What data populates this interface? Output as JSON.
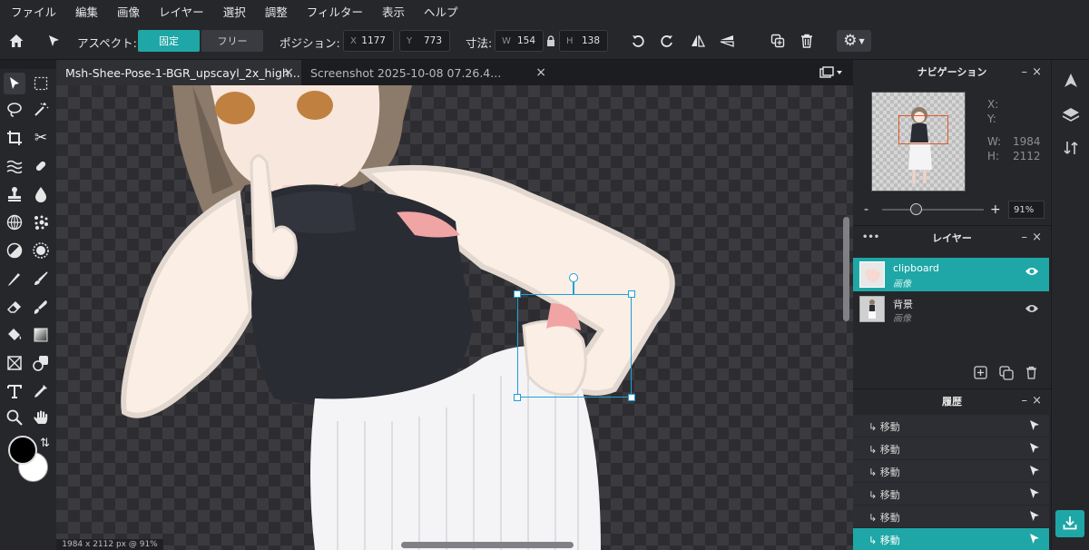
{
  "menu": [
    "ファイル",
    "編集",
    "画像",
    "レイヤー",
    "選択",
    "調整",
    "フィルター",
    "表示",
    "ヘルプ"
  ],
  "toolbar": {
    "home_icon": "home-icon",
    "move_icon": "pointer-icon",
    "aspect_label": "アスペクト:",
    "aspect_fixed": "固定",
    "aspect_free": "フリー",
    "position_label": "ポジション:",
    "x_key": "X",
    "x_val": "1177",
    "y_key": "Y",
    "y_val": "773",
    "size_label": "寸法:",
    "w_key": "W",
    "w_val": "154",
    "h_key": "H",
    "h_val": "138",
    "accent": "#1ea7a6"
  },
  "tabs": [
    {
      "label": "Msh-Shee-Pose-1-BGR_upscayl_2x_high...",
      "close": "×",
      "active": true
    },
    {
      "label": "Screenshot 2025-10-08 07.26.4...",
      "close": "×",
      "active": false
    }
  ],
  "status": "1984 x 2112 px @ 91%",
  "navigator": {
    "title": "ナビゲーション",
    "x_label": "X:",
    "y_label": "Y:",
    "w_label": "W:",
    "w_value": "1984",
    "h_label": "H:",
    "h_value": "2112",
    "zoom": "91%",
    "minus": "-",
    "plus": "+"
  },
  "layers": {
    "title": "レイヤー",
    "dots": "•••",
    "items": [
      {
        "name": "clipboard",
        "type": "画像",
        "selected": true
      },
      {
        "name": "背景",
        "type": "画像",
        "selected": false
      }
    ]
  },
  "history": {
    "title": "履歴",
    "items": [
      "↳ 移動",
      "↳ 移動",
      "↳ 移動",
      "↳ 移動",
      "↳ 移動",
      "↳ 移動"
    ]
  },
  "panel_controls": {
    "minimize": "–",
    "close": "×"
  }
}
